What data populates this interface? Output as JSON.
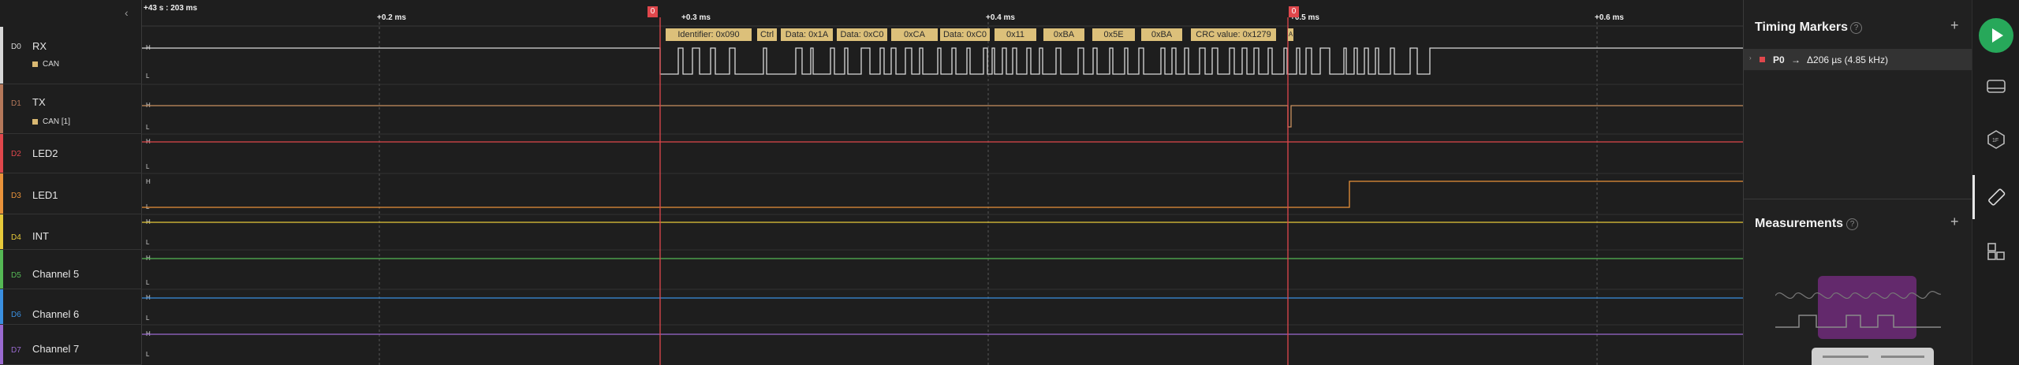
{
  "timeline": {
    "offset_label": "+43 s : 203 ms",
    "ticks": [
      "+0.2 ms",
      "+0.3 ms",
      "+0.4 ms",
      "+0.5 ms",
      "+0.6 ms"
    ]
  },
  "markers": [
    {
      "label": "0",
      "color": "#e0474c"
    },
    {
      "label": "0",
      "color": "#e0474c"
    }
  ],
  "channels": [
    {
      "num": "D0",
      "name": "RX",
      "color": "#d7d7d7",
      "analyzer": "CAN"
    },
    {
      "num": "D1",
      "name": "TX",
      "color": "#b5785a",
      "analyzer": "CAN [1]"
    },
    {
      "num": "D2",
      "name": "LED2",
      "color": "#e0474c",
      "analyzer": ""
    },
    {
      "num": "D3",
      "name": "LED1",
      "color": "#e8923a",
      "analyzer": ""
    },
    {
      "num": "D4",
      "name": "INT",
      "color": "#e6c93a",
      "analyzer": ""
    },
    {
      "num": "D5",
      "name": "Channel 5",
      "color": "#55b855",
      "analyzer": ""
    },
    {
      "num": "D6",
      "name": "Channel 6",
      "color": "#3a8fe0",
      "analyzer": ""
    },
    {
      "num": "D7",
      "name": "Channel 7",
      "color": "#9a6ad0",
      "analyzer": ""
    }
  ],
  "level_labels": {
    "high": "H",
    "low": "L"
  },
  "can_frames": [
    "Identifier: 0x090",
    "Ctrl",
    "Data: 0x1A",
    "Data: 0xC0",
    "0xCA",
    "Data: 0xC0",
    "0x11",
    "0xBA",
    "0x5E",
    "0xBA",
    "CRC value: 0x1279",
    "A"
  ],
  "panel": {
    "timing_title": "Timing Markers",
    "marker_row": {
      "name": "P0",
      "arrow": "→",
      "value": "Δ206 µs (4.85 kHz)"
    },
    "measurements_title": "Measurements",
    "help_glyph": "?",
    "add_glyph": "+"
  },
  "toolbar": {
    "icons": [
      "play-icon",
      "analyzer-icon",
      "hex-extension-icon",
      "ruler-icon",
      "layout-icon"
    ],
    "active": "ruler-icon",
    "play_color": "#27a85a"
  }
}
